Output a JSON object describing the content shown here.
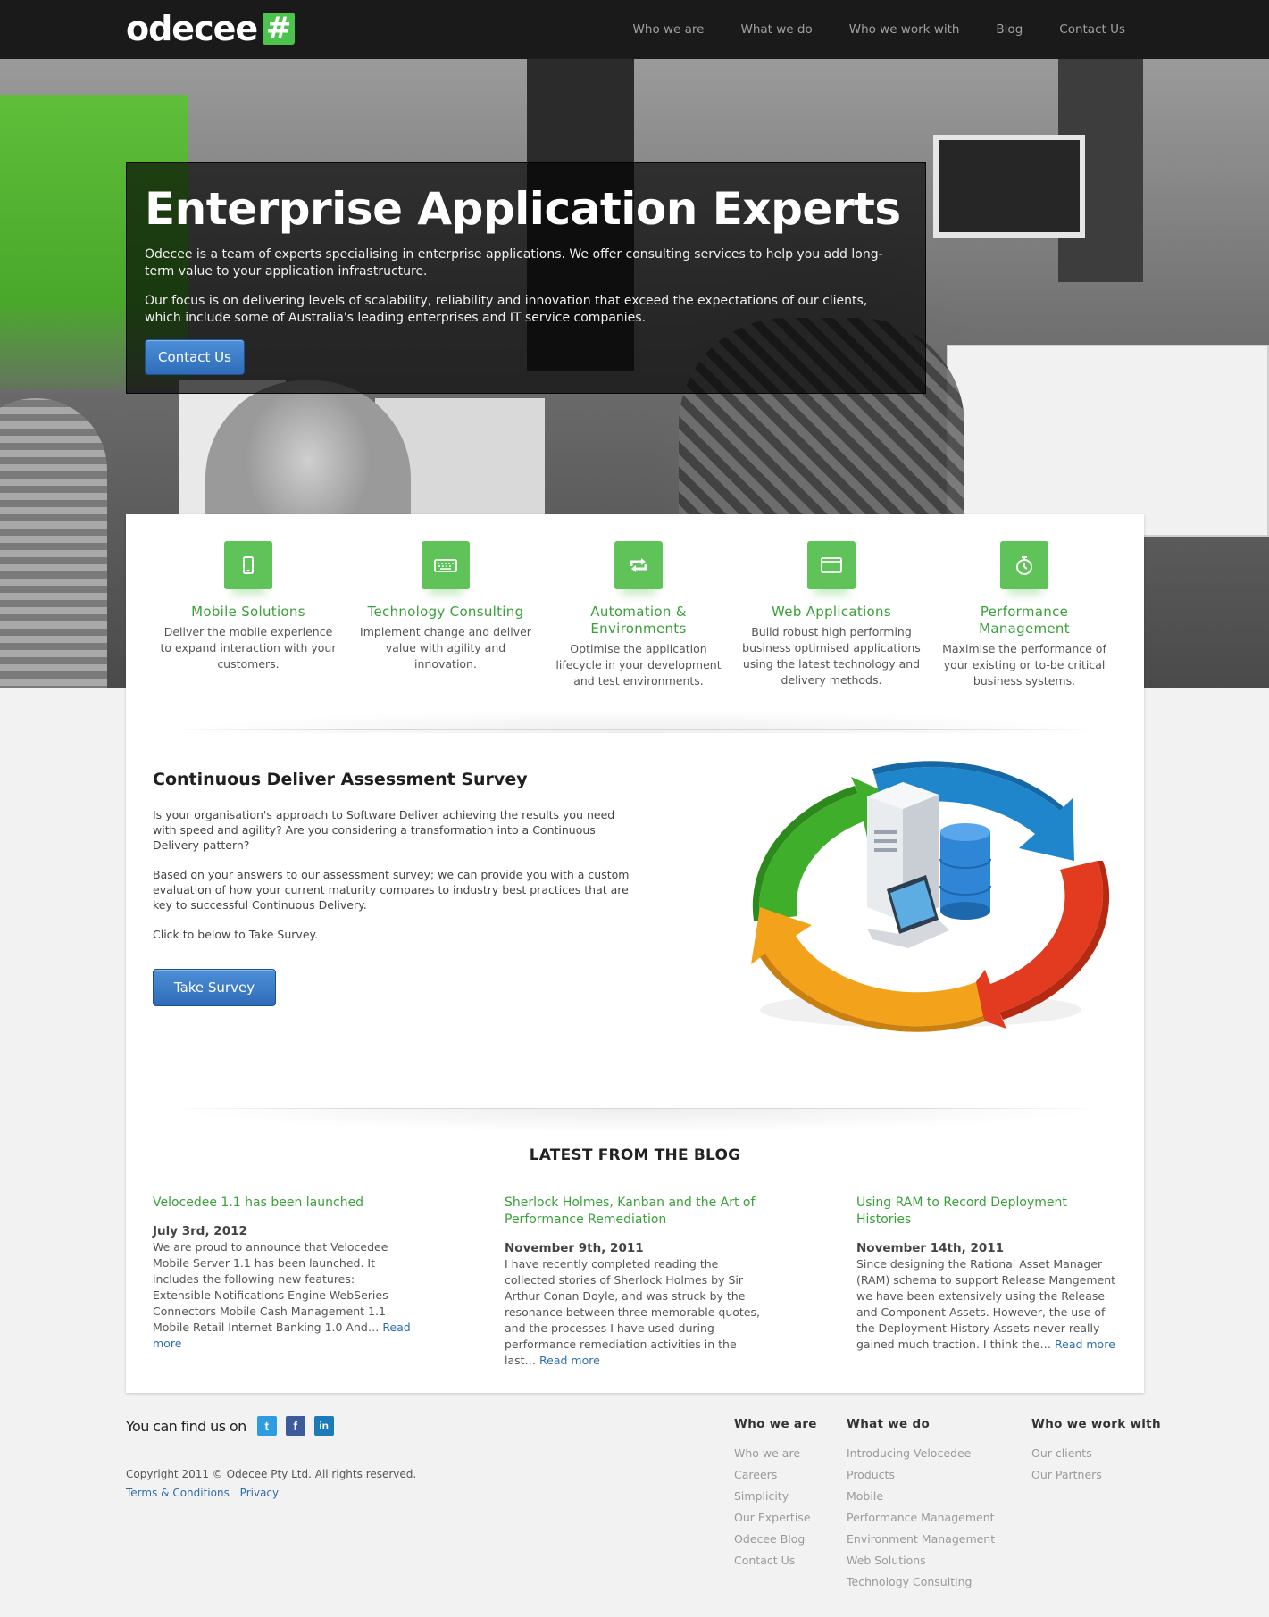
{
  "brand": {
    "name": "odecee",
    "mark": "#"
  },
  "nav": [
    {
      "label": "Who we are"
    },
    {
      "label": "What we do"
    },
    {
      "label": "Who we work with"
    },
    {
      "label": "Blog"
    },
    {
      "label": "Contact Us"
    }
  ],
  "hero": {
    "title": "Enterprise Application Experts",
    "p1": "Odecee is a team of experts specialising in enterprise applications. We offer consulting services to help you add long-term value to your application infrastructure.",
    "p2": "Our focus is on delivering levels of scalability, reliability and innovation that exceed the expectations of our clients, which include some of Australia's leading enterprises and IT service companies.",
    "cta": "Contact Us"
  },
  "services": [
    {
      "icon": "mobile-icon",
      "title": "Mobile Solutions",
      "desc": "Deliver the mobile experience to expand interaction with your customers."
    },
    {
      "icon": "keyboard-icon",
      "title": "Technology Consulting",
      "desc": "Implement change and deliver value with agility and innovation."
    },
    {
      "icon": "repeat-icon",
      "title": "Automation & Environments",
      "desc": "Optimise the application lifecycle in your development and test environments."
    },
    {
      "icon": "browser-window-icon",
      "title": "Web Applications",
      "desc": "Build robust high performing business optimised applications using the latest technology and delivery methods."
    },
    {
      "icon": "stopwatch-icon",
      "title": "Performance Management",
      "desc": "Maximise the performance of your existing or to-be critical business systems."
    }
  ],
  "survey": {
    "title": "Continuous Deliver Assessment Survey",
    "p1": "Is your organisation's approach to Software Deliver achieving the results you need with speed and agility? Are you considering a transformation into a Continuous Delivery pattern?",
    "p2": "Based on your answers to our assessment survey; we can provide you with a custom evaluation of how your current maturity compares to industry best practices that are key to successful Continuous Delivery.",
    "p3": "Click to below to Take Survey.",
    "button": "Take Survey"
  },
  "blog": {
    "heading": "LATEST FROM THE BLOG",
    "read_more": "Read more",
    "posts": [
      {
        "title": "Velocedee 1.1 has been launched",
        "date": "July 3rd, 2012",
        "excerpt": "We are proud to announce that Velocedee Mobile Server 1.1 has been launched. It includes the following new features: Extensible Notifications Engine WebSeries Connectors Mobile Cash Management 1.1 Mobile Retail Internet Banking 1.0 And… "
      },
      {
        "title": "Sherlock Holmes, Kanban and the Art of Performance Remediation",
        "date": "November 9th, 2011",
        "excerpt": "I have recently completed reading the collected stories of Sherlock Holmes by Sir Arthur Conan Doyle, and was struck by the resonance between three memorable quotes, and the processes I have used during performance remediation activities in the last… "
      },
      {
        "title": "Using RAM to Record Deployment Histories",
        "date": "November 14th, 2011",
        "excerpt": "Since designing the Rational Asset Manager (RAM) schema to support Release Mangement we have been extensively using the Release and Component Assets. However, the use of the Deployment History Assets never really gained much traction. I think the… "
      }
    ]
  },
  "footer": {
    "follow": "You can find us on",
    "social": [
      {
        "icon": "twitter-icon",
        "glyph": "t",
        "color": "#2d9ce0"
      },
      {
        "icon": "facebook-icon",
        "glyph": "f",
        "color": "#3b5b9a"
      },
      {
        "icon": "linkedin-icon",
        "glyph": "in",
        "color": "#1d7ab8"
      }
    ],
    "copyright": "Copyright 2011 © Odecee Pty Ltd. All rights reserved.",
    "terms": "Terms & Conditions",
    "privacy": "Privacy",
    "columns": [
      {
        "title": "Who we are",
        "links": [
          "Who we are",
          "Careers",
          "Simplicity",
          "Our Expertise",
          "Odecee Blog",
          "Contact Us"
        ]
      },
      {
        "title": "What we do",
        "links": [
          "Introducing Velocedee",
          "Products",
          "Mobile",
          "Performance Management",
          "Environment Management",
          "Web Solutions",
          "Technology Consulting"
        ]
      },
      {
        "title": "Who we work with",
        "links": [
          "Our clients",
          "Our Partners"
        ]
      }
    ]
  },
  "colors": {
    "accent_green": "#3aa03a",
    "icon_green": "#5fc35a",
    "link_blue": "#2e6dad",
    "button_blue": "#2f6cb8",
    "topbar": "#1a1a1a"
  }
}
